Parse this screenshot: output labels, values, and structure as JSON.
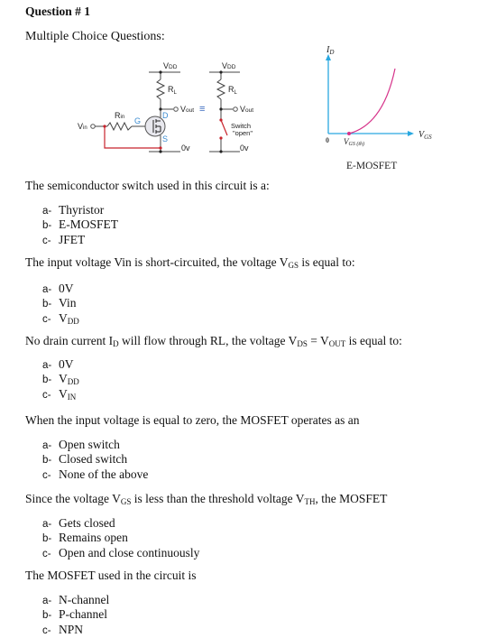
{
  "header": {
    "title": "Question # 1",
    "subtitle": "Multiple Choice Questions:"
  },
  "figure": {
    "circuit": {
      "vdd_label": "V",
      "vdd_sub": "DD",
      "rl_label": "R",
      "rl_sub": "L",
      "vout_label": "V",
      "vout_sub": "out",
      "rin_label": "R",
      "rin_sub": "in",
      "vin_label": "V",
      "vin_sub": "in",
      "gate_label": "G",
      "drain_label": "D",
      "source_label": "S",
      "ground_label": "0v",
      "equivalent_symbol": "≡",
      "switch_label_line1": "Switch",
      "switch_label_line2": "\"open\""
    },
    "graph": {
      "y_axis_label": "I",
      "y_axis_sub": "D",
      "x_axis_label": "V",
      "x_axis_sub": "GS",
      "origin_label": "0",
      "threshold_label": "V",
      "threshold_sub": "GS (th)",
      "caption": "E-MOSFET",
      "axis_color": "#29a8e0",
      "curve_color": "#d6338a"
    }
  },
  "questions": [
    {
      "parts": [
        {
          "t": "The semiconductor switch used in this circuit is a:"
        }
      ],
      "options": [
        {
          "letter": "a-",
          "parts": [
            {
              "t": "Thyristor"
            }
          ]
        },
        {
          "letter": "b-",
          "parts": [
            {
              "t": "E-MOSFET"
            }
          ]
        },
        {
          "letter": "c-",
          "parts": [
            {
              "t": "JFET"
            }
          ]
        }
      ]
    },
    {
      "parts": [
        {
          "t": "The input voltage Vin is short-circuited, the voltage V"
        },
        {
          "s": "GS"
        },
        {
          "t": " is equal to:"
        }
      ],
      "options": [
        {
          "letter": "a-",
          "parts": [
            {
              "t": "0V"
            }
          ]
        },
        {
          "letter": "b-",
          "parts": [
            {
              "t": "Vin"
            }
          ]
        },
        {
          "letter": "c-",
          "parts": [
            {
              "t": "V"
            },
            {
              "s": "DD"
            }
          ]
        }
      ]
    },
    {
      "parts": [
        {
          "t": "No drain current I"
        },
        {
          "s": "D"
        },
        {
          "t": " will flow through RL, the voltage V"
        },
        {
          "s": "DS"
        },
        {
          "t": " = V"
        },
        {
          "s": "OUT"
        },
        {
          "t": " is equal to:"
        }
      ],
      "options": [
        {
          "letter": "a-",
          "parts": [
            {
              "t": "0V"
            }
          ]
        },
        {
          "letter": "b-",
          "parts": [
            {
              "t": "V"
            },
            {
              "s": "DD"
            }
          ]
        },
        {
          "letter": "c-",
          "parts": [
            {
              "t": "V"
            },
            {
              "s": "IN"
            }
          ]
        }
      ]
    },
    {
      "parts": [
        {
          "t": "When the input voltage is equal to zero, the MOSFET operates as an"
        }
      ],
      "options": [
        {
          "letter": "a-",
          "parts": [
            {
              "t": "Open switch"
            }
          ]
        },
        {
          "letter": "b-",
          "parts": [
            {
              "t": "Closed switch"
            }
          ]
        },
        {
          "letter": "c-",
          "parts": [
            {
              "t": "None of the above"
            }
          ]
        }
      ]
    },
    {
      "parts": [
        {
          "t": "Since the voltage V"
        },
        {
          "s": "GS"
        },
        {
          "t": " is less than the threshold voltage V"
        },
        {
          "s": "TH"
        },
        {
          "t": ", the MOSFET"
        }
      ],
      "options": [
        {
          "letter": "a-",
          "parts": [
            {
              "t": "Gets closed"
            }
          ]
        },
        {
          "letter": "b-",
          "parts": [
            {
              "t": "Remains open"
            }
          ]
        },
        {
          "letter": "c-",
          "parts": [
            {
              "t": "Open and close continuously"
            }
          ]
        }
      ]
    },
    {
      "parts": [
        {
          "t": "The MOSFET used in the circuit is"
        }
      ],
      "options": [
        {
          "letter": "a-",
          "parts": [
            {
              "t": "N-channel"
            }
          ]
        },
        {
          "letter": "b-",
          "parts": [
            {
              "t": "P-channel"
            }
          ]
        },
        {
          "letter": "c-",
          "parts": [
            {
              "t": "NPN"
            }
          ]
        }
      ]
    }
  ]
}
